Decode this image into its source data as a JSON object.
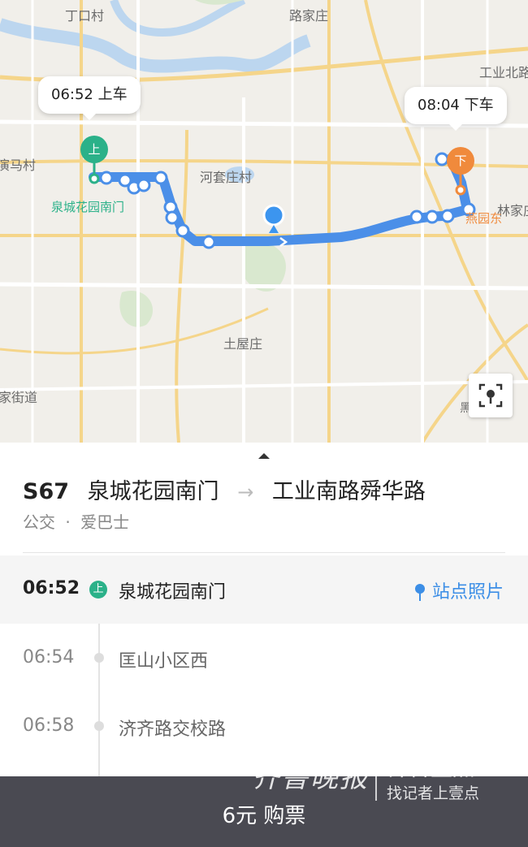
{
  "map": {
    "labels": [
      "丁口村",
      "路家庄",
      "工业北路",
      "演马村",
      "河套庄村",
      "泉城花园南门",
      "林家庄",
      "燕园东",
      "土屋庄",
      "家街道",
      "黑"
    ],
    "board_callout": "06:52 上车",
    "alight_callout": "08:04 下车",
    "board_pin": "上",
    "alight_pin": "下",
    "colors": {
      "route": "#4b8fe8",
      "board": "#2bb189",
      "alight": "#f08a3c"
    }
  },
  "route": {
    "code": "S67",
    "from": "泉城花园南门",
    "to": "工业南路舜华路",
    "type": "公交",
    "operator": "爱巴士",
    "sep": "·"
  },
  "stops": [
    {
      "time": "06:52",
      "name": "泉城花园南门",
      "badge": "上"
    },
    {
      "time": "06:54",
      "name": "匡山小区西"
    },
    {
      "time": "06:58",
      "name": "济齐路交校路"
    }
  ],
  "photo_link": "站点照片",
  "buy_button": "6元 购票",
  "watermark": {
    "brand": "齐鲁晚报",
    "app": "齐鲁壹点",
    "slogan": "找记者上壹点"
  }
}
